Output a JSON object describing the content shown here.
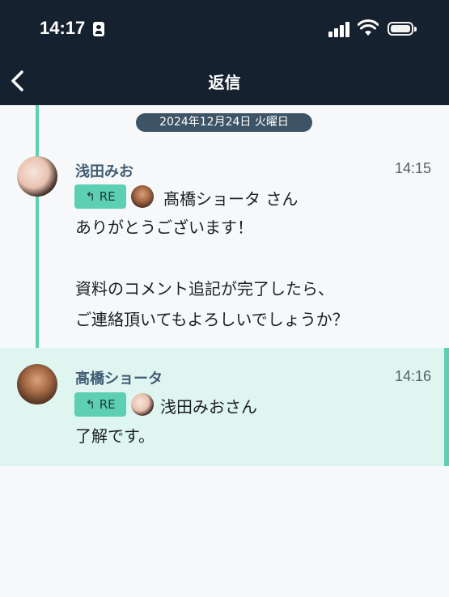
{
  "status_bar": {
    "time": "14:17"
  },
  "nav": {
    "title": "返信"
  },
  "date_divider": "2024年12月24日 火曜日",
  "messages": [
    {
      "sender": "浅田みお",
      "time": "14:15",
      "reply_badge": "↰ RE",
      "reply_to": "髙橋ショータ さん",
      "body": "ありがとうございます！\n \n資料のコメント追記が完了したら、\nご連絡頂いてもよろしいでしょうか？"
    },
    {
      "sender": "髙橋ショータ",
      "time": "14:16",
      "reply_badge": "↰ RE",
      "reply_to": "浅田みおさん",
      "body": "了解です。"
    }
  ],
  "colors": {
    "header_bg": "#16212f",
    "accent": "#5dcfb3",
    "highlight_bg": "#dff5f0",
    "sender_name": "#3f5c74"
  },
  "icons": [
    "person-id-icon",
    "cellular-signal-icon",
    "wifi-icon",
    "battery-icon",
    "back-chevron-icon"
  ]
}
